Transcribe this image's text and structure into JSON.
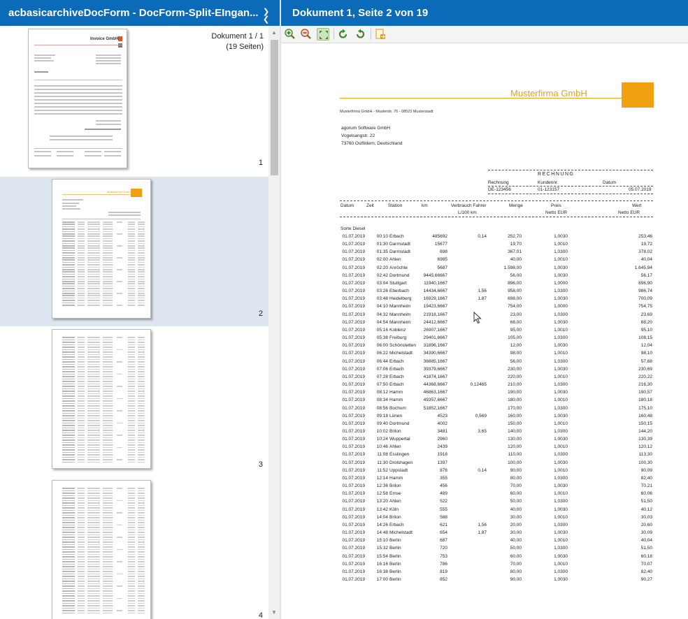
{
  "left_panel": {
    "title": "acbasicarchiveDocForm - DocForm-Split-EIngan...",
    "doc_count_line1": "Dokument 1 / 1",
    "doc_count_line2": "(19 Seiten)",
    "thumbnails": [
      {
        "num": "1",
        "selected": false
      },
      {
        "num": "2",
        "selected": true
      },
      {
        "num": "3",
        "selected": false
      },
      {
        "num": "4",
        "selected": false
      }
    ],
    "thumb1_company": "Invoice GmbH",
    "thumb2_company": "Musterfirma GmbH"
  },
  "right_panel": {
    "title": "Dokument 1, Seite 2 von 19",
    "toolbar": [
      {
        "name": "zoom-in-icon"
      },
      {
        "name": "zoom-out-icon"
      },
      {
        "name": "fit-page-icon"
      },
      {
        "name": "rotate-left-icon"
      },
      {
        "name": "rotate-right-icon"
      },
      {
        "name": "export-icon"
      }
    ]
  },
  "invoice": {
    "company": "Musterfirma GmbH",
    "sender_line": "Musterfirma GmbH - Musterstr. 76 - 08523 Musterstadt",
    "recipient": [
      "agorum Software GmbH",
      "Vogelsangstr. 22",
      "73760 Ostfildern, Deutschland"
    ],
    "meta_title": "RECHNUNG",
    "meta_labels": [
      "Rechnung",
      "Kundennr.",
      "Datum"
    ],
    "meta_values": [
      "DE-123456",
      "01-123157",
      "05.07.2019"
    ],
    "headers": {
      "datum": "Datum",
      "zeit": "Zeit",
      "station": "Station",
      "km": "km",
      "verbrauch1": "Verbrauch Fahrer",
      "verbrauch2": "L/100 km",
      "menge": "Menge",
      "preis": "Preis",
      "preis_unit": "Netto EUR",
      "wert": "Wert",
      "wert_unit": "Netto EUR"
    },
    "sorte": "Sorte Diesel",
    "rows": [
      [
        "01.07.2019",
        "00:10",
        "Erbach",
        "485692",
        "0,14",
        "252,70",
        "1,0030",
        "253,46"
      ],
      [
        "01.07.2019",
        "01:30",
        "Darmstadt",
        "15677",
        "",
        "19,70",
        "1,0010",
        "19,72"
      ],
      [
        "01.07.2019",
        "01:35",
        "Darmstadt",
        "698",
        "",
        "367,01",
        "1,0300",
        "378,02"
      ],
      [
        "01.07.2019",
        "02:00",
        "Ahlen",
        "6985",
        "",
        "40,00",
        "1,0010",
        "40,04"
      ],
      [
        "01.07.2019",
        "02:20",
        "Anröchte",
        "5687",
        "",
        "1.598,00",
        "1,0030",
        "1.645,94"
      ],
      [
        "01.07.2019",
        "02:42",
        "Dortmund",
        "9445,66667",
        "",
        "56,00",
        "1,0030",
        "56,17"
      ],
      [
        "01.07.2019",
        "03:04",
        "Stuttgart",
        "11940,1667",
        "",
        "896,00",
        "1,0000",
        "896,90"
      ],
      [
        "01.07.2019",
        "03:26",
        "Eberbach",
        "14434,6667",
        "1,56",
        "958,00",
        "1,0300",
        "986,74"
      ],
      [
        "01.07.2019",
        "03:48",
        "Heidelberg",
        "16929,1667",
        "1,87",
        "698,00",
        "1,0030",
        "700,09"
      ],
      [
        "01.07.2019",
        "04:10",
        "Mannheim",
        "19423,6667",
        "",
        "754,00",
        "1,0000",
        "754,75"
      ],
      [
        "01.07.2019",
        "04:32",
        "Mannheim",
        "21918,1667",
        "",
        "23,00",
        "1,0300",
        "23,69"
      ],
      [
        "01.07.2019",
        "04:54",
        "Mannheim",
        "24412,6667",
        "",
        "68,00",
        "1,0030",
        "68,20"
      ],
      [
        "01.07.2019",
        "05:16",
        "Koblenz",
        "26907,1667",
        "",
        "95,00",
        "1,0010",
        "95,10"
      ],
      [
        "01.07.2019",
        "05:38",
        "Freiburg",
        "29401,6667",
        "",
        "105,00",
        "1,0300",
        "108,15"
      ],
      [
        "01.07.2019",
        "06:00",
        "Schönstetten",
        "31896,1667",
        "",
        "12,00",
        "1,0030",
        "12,04"
      ],
      [
        "01.07.2019",
        "06:22",
        "Michelstadt",
        "34390,6667",
        "",
        "98,00",
        "1,0010",
        "98,10"
      ],
      [
        "01.07.2019",
        "06:44",
        "Erbach",
        "36885,1667",
        "",
        "56,00",
        "1,0300",
        "57,68"
      ],
      [
        "01.07.2019",
        "07:06",
        "Erbach",
        "39379,6667",
        "",
        "230,00",
        "1,0030",
        "230,69"
      ],
      [
        "01.07.2019",
        "07:28",
        "Erbach",
        "41874,1667",
        "",
        "220,00",
        "1,0010",
        "220,22"
      ],
      [
        "01.07.2019",
        "07:50",
        "Erbach",
        "44368,6667",
        "0,12465",
        "210,00",
        "1,0300",
        "216,30"
      ],
      [
        "01.07.2019",
        "08:12",
        "Hamm",
        "46863,1667",
        "",
        "190,00",
        "1,0030",
        "190,57"
      ],
      [
        "01.07.2019",
        "08:34",
        "Hamm",
        "49357,6667",
        "",
        "180,00",
        "1,0010",
        "180,18"
      ],
      [
        "01.07.2019",
        "08:56",
        "Bochum",
        "51852,1667",
        "",
        "170,00",
        "1,0300",
        "175,10"
      ],
      [
        "01.07.2019",
        "09:18",
        "Lünen",
        "4523",
        "0,569",
        "160,00",
        "1,0030",
        "160,48"
      ],
      [
        "01.07.2019",
        "09:40",
        "Dortmund",
        "4002",
        "",
        "150,00",
        "1,0010",
        "150,15"
      ],
      [
        "01.07.2019",
        "10:02",
        "Brilon",
        "3481",
        "3,65",
        "140,00",
        "1,0300",
        "144,20"
      ],
      [
        "01.07.2019",
        "10:24",
        "Wuppertal",
        "2960",
        "",
        "130,00",
        "1,0030",
        "130,39"
      ],
      [
        "01.07.2019",
        "10:46",
        "Ahlen",
        "2439",
        "",
        "120,00",
        "1,0010",
        "120,12"
      ],
      [
        "01.07.2019",
        "11:08",
        "Esslingen",
        "1918",
        "",
        "110,00",
        "1,0300",
        "113,30"
      ],
      [
        "01.07.2019",
        "11:30",
        "Drolshagen",
        "1397",
        "",
        "100,00",
        "1,0030",
        "100,30"
      ],
      [
        "01.07.2019",
        "11:52",
        "Uppstadt",
        "876",
        "0,14",
        "90,00",
        "1,0010",
        "90,09"
      ],
      [
        "01.07.2019",
        "12:14",
        "Hamm",
        "355",
        "",
        "80,00",
        "1,0300",
        "82,40"
      ],
      [
        "01.07.2019",
        "12:36",
        "Brilon",
        "456",
        "",
        "70,00",
        "1,0030",
        "70,21"
      ],
      [
        "01.07.2019",
        "12:58",
        "Emse",
        "489",
        "",
        "60,00",
        "1,0010",
        "60,06"
      ],
      [
        "01.07.2019",
        "13:20",
        "Ahlen",
        "522",
        "",
        "50,00",
        "1,0300",
        "51,50"
      ],
      [
        "01.07.2019",
        "13:42",
        "Köln",
        "555",
        "",
        "40,00",
        "1,0030",
        "40,12"
      ],
      [
        "01.07.2019",
        "14:04",
        "Brilon",
        "588",
        "",
        "30,00",
        "1,0010",
        "30,03"
      ],
      [
        "01.07.2019",
        "14:26",
        "Erbach",
        "621",
        "1,56",
        "20,00",
        "1,0300",
        "20,60"
      ],
      [
        "01.07.2019",
        "14:48",
        "Michelstadt",
        "654",
        "1,87",
        "30,00",
        "1,0030",
        "30,09"
      ],
      [
        "01.07.2019",
        "15:10",
        "Berlin",
        "687",
        "",
        "40,00",
        "1,0010",
        "40,04"
      ],
      [
        "01.07.2019",
        "15:32",
        "Berlin",
        "720",
        "",
        "50,00",
        "1,0300",
        "51,50"
      ],
      [
        "01.07.2019",
        "15:54",
        "Berlin",
        "753",
        "",
        "60,00",
        "1,0030",
        "60,18"
      ],
      [
        "01.07.2019",
        "16:16",
        "Berlin",
        "786",
        "",
        "70,00",
        "1,0010",
        "70,07"
      ],
      [
        "01.07.2019",
        "16:38",
        "Berlin",
        "819",
        "",
        "80,00",
        "1,0300",
        "82,40"
      ],
      [
        "01.07.2019",
        "17:00",
        "Berlin",
        "852",
        "",
        "90,00",
        "1,0030",
        "90,27"
      ]
    ]
  },
  "colors": {
    "header_blue": "#0b6bb8",
    "accent_orange": "#f0a010",
    "selected_row": "#dde6f0"
  }
}
